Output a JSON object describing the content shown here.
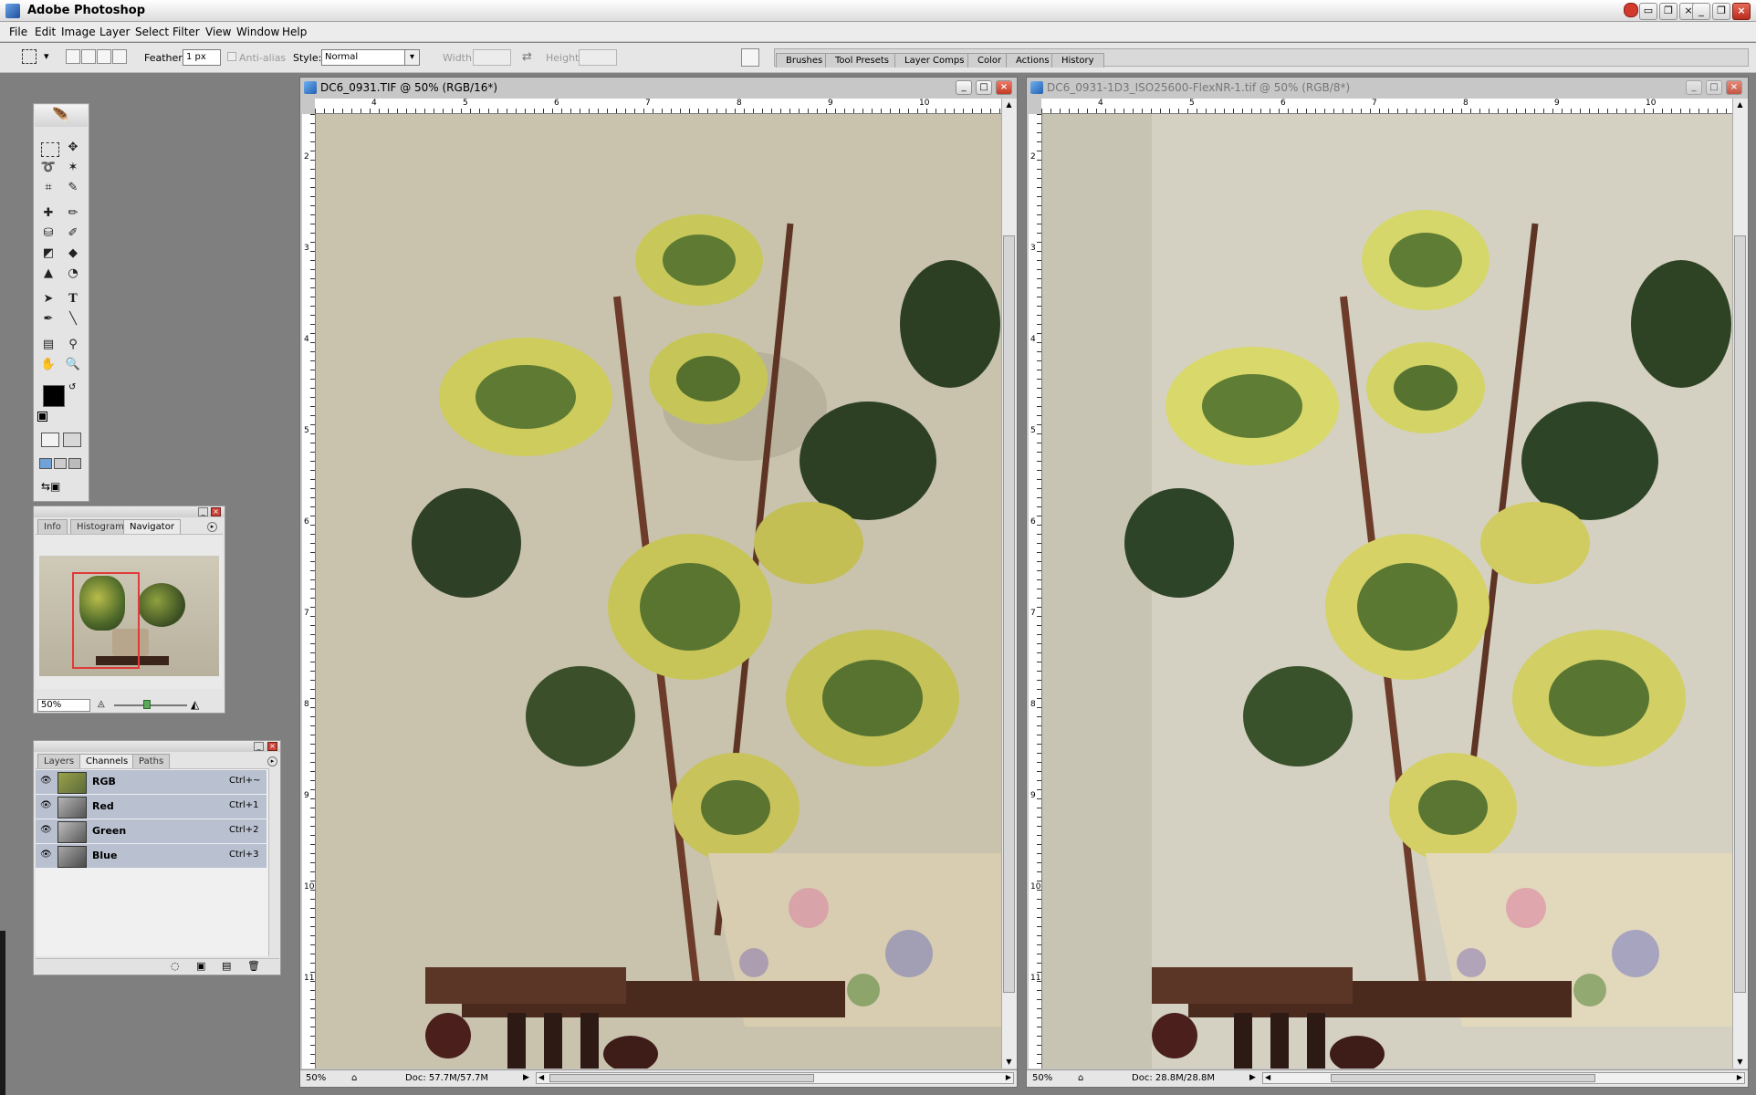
{
  "app": {
    "title": "Adobe Photoshop"
  },
  "menu": [
    "File",
    "Edit",
    "Image",
    "Layer",
    "Select",
    "Filter",
    "View",
    "Window",
    "Help"
  ],
  "options": {
    "feather_label": "Feather:",
    "feather_value": "1 px",
    "antialias_label": "Anti-alias",
    "style_label": "Style:",
    "style_value": "Normal",
    "width_label": "Width:",
    "height_label": "Height:"
  },
  "palette_well": [
    "Brushes",
    "Tool Presets",
    "Layer Comps",
    "Color",
    "Actions",
    "History"
  ],
  "navigator": {
    "tabs": [
      "Info",
      "Histogram",
      "Navigator"
    ],
    "zoom": "50%"
  },
  "channels": {
    "tabs": [
      "Layers",
      "Channels",
      "Paths"
    ],
    "rows": [
      {
        "name": "RGB",
        "shortcut": "Ctrl+~"
      },
      {
        "name": "Red",
        "shortcut": "Ctrl+1"
      },
      {
        "name": "Green",
        "shortcut": "Ctrl+2"
      },
      {
        "name": "Blue",
        "shortcut": "Ctrl+3"
      }
    ]
  },
  "documents": [
    {
      "title": "DC6_0931.TIF @ 50% (RGB/16*)",
      "zoom": "50%",
      "doc_info": "Doc: 57.7M/57.7M",
      "ruler_h": [
        "4",
        "5",
        "6",
        "7",
        "8",
        "9",
        "10"
      ],
      "ruler_v": [
        "2",
        "3",
        "4",
        "5",
        "6",
        "7",
        "8",
        "9",
        "10",
        "11"
      ]
    },
    {
      "title": "DC6_0931-1D3_ISO25600-FlexNR-1.tif @ 50% (RGB/8*)",
      "zoom": "50%",
      "doc_info": "Doc: 28.8M/28.8M",
      "ruler_h": [
        "4",
        "5",
        "6",
        "7",
        "8",
        "9",
        "10"
      ],
      "ruler_v": [
        "2",
        "3",
        "4",
        "5",
        "6",
        "7",
        "8",
        "9",
        "10",
        "11"
      ]
    }
  ],
  "colors": {
    "foreground": "#000000",
    "background": "#ffffff",
    "workspace": "#7f7f7f",
    "channel_row": "#b9c0cf",
    "navigator_view_box": "#e03a3a"
  },
  "icons": [
    "photoshop-logo-icon",
    "feather-icon",
    "eye-icon",
    "close-icon",
    "minimize-icon",
    "maximize-icon"
  ]
}
